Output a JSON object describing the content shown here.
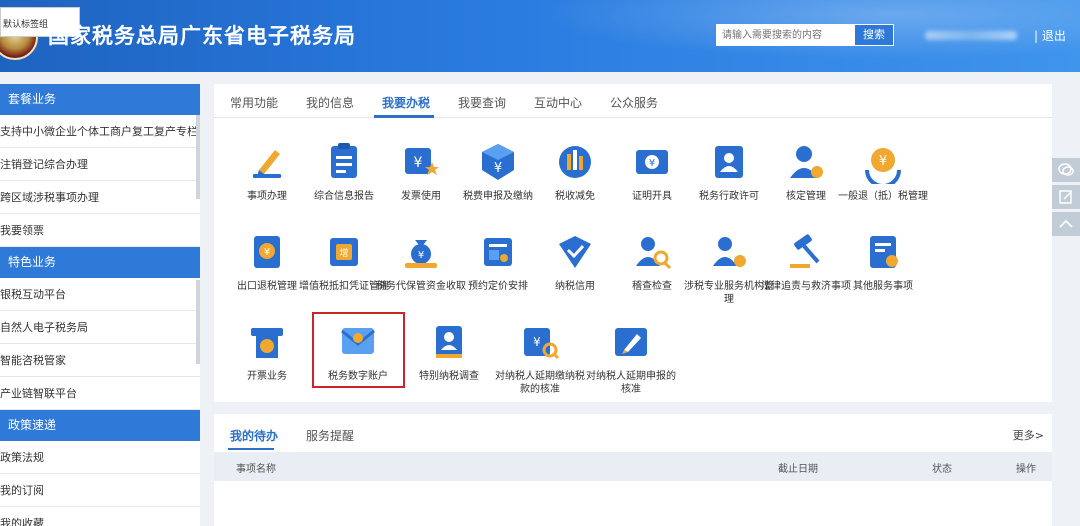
{
  "header": {
    "title": "国家税务总局广东省电子税务局",
    "tooltip": "默认标签组",
    "search_placeholder": "请输入需要搜索的内容",
    "search_button": "搜索",
    "separator": "|",
    "logout": "退出",
    "accent": "#2a7be0"
  },
  "sidebar": {
    "sections": [
      {
        "title": "套餐业务",
        "items": [
          "支持中小微企业个体工商户复工复产专栏",
          "注销登记综合办理",
          "跨区域涉税事项办理",
          "我要领票"
        ]
      },
      {
        "title": "特色业务",
        "items": [
          "银税互动平台",
          "自然人电子税务局",
          "智能咨税管家",
          "产业链智联平台"
        ]
      },
      {
        "title": "政策速递",
        "items": [
          "政策法规",
          "我的订阅",
          "我的收藏"
        ]
      }
    ]
  },
  "main": {
    "tabs": [
      "常用功能",
      "我的信息",
      "我要办税",
      "我要查询",
      "互动中心",
      "公众服务"
    ],
    "active_tab": "我要办税",
    "services": [
      {
        "label": "事项办理",
        "icon": "pen-icon"
      },
      {
        "label": "综合信息报告",
        "icon": "report-icon"
      },
      {
        "label": "发票使用",
        "icon": "invoice-icon"
      },
      {
        "label": "税费申报及缴纳",
        "icon": "declare-icon"
      },
      {
        "label": "税收减免",
        "icon": "reduction-icon"
      },
      {
        "label": "证明开具",
        "icon": "certificate-icon"
      },
      {
        "label": "税务行政许可",
        "icon": "license-icon"
      },
      {
        "label": "核定管理",
        "icon": "approval-icon"
      },
      {
        "label": "一般退（抵）税管理",
        "icon": "refund-icon"
      },
      {
        "label": "出口退税管理",
        "icon": "export-refund-icon"
      },
      {
        "label": "增值税抵扣凭证管理",
        "icon": "vat-icon"
      },
      {
        "label": "税务代保管资金收取",
        "icon": "money-bag-icon"
      },
      {
        "label": "预约定价安排",
        "icon": "pricing-icon"
      },
      {
        "label": "纳税信用",
        "icon": "credit-icon"
      },
      {
        "label": "稽查检查",
        "icon": "inspection-icon"
      },
      {
        "label": "涉税专业服务机构管理",
        "icon": "agency-icon"
      },
      {
        "label": "法律追责与救济事项",
        "icon": "gavel-icon"
      },
      {
        "label": "其他服务事项",
        "icon": "other-service-icon"
      },
      {
        "label": "开票业务",
        "icon": "billing-icon"
      },
      {
        "label": "税务数字账户",
        "icon": "digital-account-icon"
      },
      {
        "label": "特别纳税调查",
        "icon": "investigation-icon"
      },
      {
        "label": "对纳税人延期缴纳税款的核准",
        "icon": "delay-payment-icon"
      },
      {
        "label": "对纳税人延期申报的核准",
        "icon": "delay-declare-icon"
      }
    ],
    "highlighted_service": "税务数字账户",
    "highlight_color": "#c9252a"
  },
  "todo": {
    "tabs": [
      "我的待办",
      "服务提醒"
    ],
    "active_tab": "我的待办",
    "more": "更多>",
    "columns": [
      "事项名称",
      "截止日期",
      "状态",
      "操作"
    ]
  }
}
